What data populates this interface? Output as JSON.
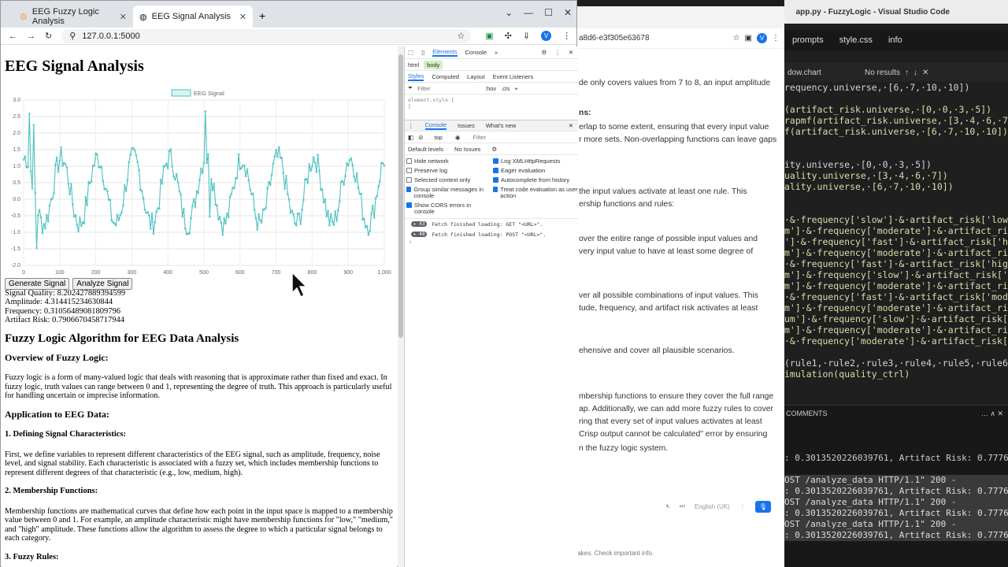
{
  "vscode": {
    "title": "app.py - FuzzyLogic - Visual Studio Code",
    "tabs": [
      "prompts",
      "style.css",
      "info"
    ],
    "find_text": "dow.chart",
    "find_result": "No results",
    "code_lines": [
      "requency.universe,·[6,·7,·10,·10])",
      "",
      "(artifact_risk.universe,·[0,·0,·3,·5])",
      "rapmf(artifact_risk.universe,·[3,·4,·6,·7])",
      "f(artifact_risk.universe,·[6,·7,·10,·10])",
      "",
      "",
      "ity.universe,·[0,·0,·3,·5])",
      "uality.universe,·[3,·4,·6,·7])",
      "ality.universe,·[6,·7,·10,·10])",
      "",
      "",
      "·&·frequency['slow']·&·artifact_risk['low'],·c",
      "m']·&·frequency['moderate']·&·artifact_risk[",
      "']·&·frequency['fast']·&·artifact_risk['high',",
      "m']·&·frequency['moderate']·&·artifact_risk['",
      "·&·frequency['fast']·&·artifact_risk['high'],",
      "m']·&·frequency['slow']·&·artifact_risk['hi",
      "m']·&·frequency['moderate']·&·artifact_risk['h",
      "·&·frequency['fast']·&·artifact_risk['moderate",
      "m']·&·frequency['moderate']·&·artifact_risk['low",
      "um']·&·frequency['slow']·&·artifact_risk['mode",
      "m']·&·frequency['moderate']·&·artifact_risk['mod",
      "·&·frequency['moderate']·&·artifact_risk['hi",
      "",
      "(rule1,·rule2,·rule3,·rule4,·rule5,·rule6,·ru",
      "imulation(quality_ctrl)"
    ],
    "panel_label": "COMMENTS",
    "terminal_lines": [
      ": 0.3013520226039761, Artifact Risk: 0.77766526",
      "",
      "OST /analyze_data HTTP/1.1\" 200 -",
      ": 0.3013520226039761, Artifact Risk: 0.77766526",
      "OST /analyze_data HTTP/1.1\" 200 -",
      ": 0.3013520226039761, Artifact Risk: 0.77766526",
      "OST /analyze_data HTTP/1.1\" 200 -",
      ": 0.3013520226039761, Artifact Risk: 0.77766526"
    ]
  },
  "chat": {
    "url_fragment": "a8d6-e3f305e63678",
    "lines": [
      "de only covers values from 7 to 8, an input amplitude",
      "ns:",
      "erlap to some extent, ensuring that every input value",
      "r more sets. Non-overlapping functions can leave gaps",
      "the input values activate at least one rule. This",
      "ership functions and rules:",
      "over the entire range of possible input values and",
      "very input value to have at least some degree of",
      "ver all possible combinations of input values. This",
      "tude, frequency, and artifact risk activates at least",
      "ehensive and cover all plausible scenarios.",
      "mbership functions to ensure they cover the full range",
      "ap. Additionally, we can add more fuzzy rules to cover",
      "ring that every set of input values activates at least",
      "Crisp output cannot be calculated\" error by ensuring",
      "n the fuzzy logic system."
    ],
    "language": "English (UK)",
    "footer": "takes. Check important info."
  },
  "browser": {
    "tabs": [
      {
        "label": "EEG Fuzzy Logic Analysis"
      },
      {
        "label": "EEG Signal Analysis"
      }
    ],
    "url": "127.0.0.1:5000",
    "avatar_letter": "V"
  },
  "page": {
    "title": "EEG Signal Analysis",
    "buttons": {
      "generate": "Generate Signal",
      "analyze": "Analyze Signal"
    },
    "results": {
      "quality": "Signal Quality: 8.202427889394599",
      "amplitude": "Amplitude: 4.314415234630844",
      "frequency": "Frequency: 0.31056489081809796",
      "artifact": "Artifact Risk: 0.7906670458717944"
    },
    "article": {
      "heading": "Fuzzy Logic Algorithm for EEG Data Analysis",
      "overview_title": "Overview of Fuzzy Logic:",
      "overview_text": "Fuzzy logic is a form of many-valued logic that deals with reasoning that is approximate rather than fixed and exact. In fuzzy logic, truth values can range between 0 and 1, representing the degree of truth. This approach is particularly useful for handling uncertain or imprecise information.",
      "application_title": "Application to EEG Data:",
      "sec1_title": "1. Defining Signal Characteristics:",
      "sec1_text": "First, we define variables to represent different characteristics of the EEG signal, such as amplitude, frequency, noise level, and signal stability. Each characteristic is associated with a fuzzy set, which includes membership functions to represent different degrees of that characteristic (e.g., low, medium, high).",
      "sec2_title": "2. Membership Functions:",
      "sec2_text": "Membership functions are mathematical curves that define how each point in the input space is mapped to a membership value between 0 and 1. For example, an amplitude characteristic might have membership functions for \"low,\" \"medium,\" and \"high\" amplitude. These functions allow the algorithm to assess the degree to which a particular signal belongs to each category.",
      "sec3_title": "3. Fuzzy Rules:"
    }
  },
  "devtools": {
    "tabs": [
      "Elements",
      "Console"
    ],
    "breadcrumb": [
      "html",
      "body"
    ],
    "subtabs": [
      "Styles",
      "Computed",
      "Layout",
      "Event Listeners"
    ],
    "filter": "Filter",
    "hov": ":hov",
    "cls": ".cls",
    "style_line": "element.style {",
    "style_close": "}",
    "drawer_tabs": [
      "Console",
      "Issues",
      "What's new"
    ],
    "context": "top",
    "console_filter": "Filter",
    "levels": "Default levels",
    "issues": "No Issues",
    "settings": [
      {
        "label": "Hide network",
        "on": false
      },
      {
        "label": "Log XMLHttpRequests",
        "on": true
      },
      {
        "label": "Preserve log",
        "on": false
      },
      {
        "label": "Eager evaluation",
        "on": true
      },
      {
        "label": "Selected context only",
        "on": false
      },
      {
        "label": "Autocomplete from history",
        "on": true
      },
      {
        "label": "Group similar messages in console",
        "on": true
      },
      {
        "label": "Treat code evaluation as user action",
        "on": true
      },
      {
        "label": "Show CORS errors in console",
        "on": true
      }
    ],
    "logs": [
      {
        "count": "43",
        "text": "Fetch finished loading: GET \"<URL>\"."
      },
      {
        "count": "48",
        "text": "Fetch finished loading: POST \"<URL>\"."
      }
    ]
  },
  "chart_data": {
    "type": "line",
    "series_name": "EEG Signal",
    "x_ticks": [
      0,
      100,
      200,
      300,
      400,
      500,
      600,
      700,
      800,
      900,
      1000
    ],
    "y_ticks": [
      3.0,
      2.5,
      2.0,
      1.5,
      1.0,
      0.5,
      0.0,
      -0.5,
      -1.0,
      -1.5,
      -2.0
    ],
    "xlim": [
      0,
      1000
    ],
    "ylim": [
      -2.0,
      3.0
    ],
    "color": "#4bc0c0",
    "grid": true,
    "legend": "top",
    "approx_period": 100,
    "approx_amplitude": 1.0,
    "approx_offset": 0.25
  }
}
